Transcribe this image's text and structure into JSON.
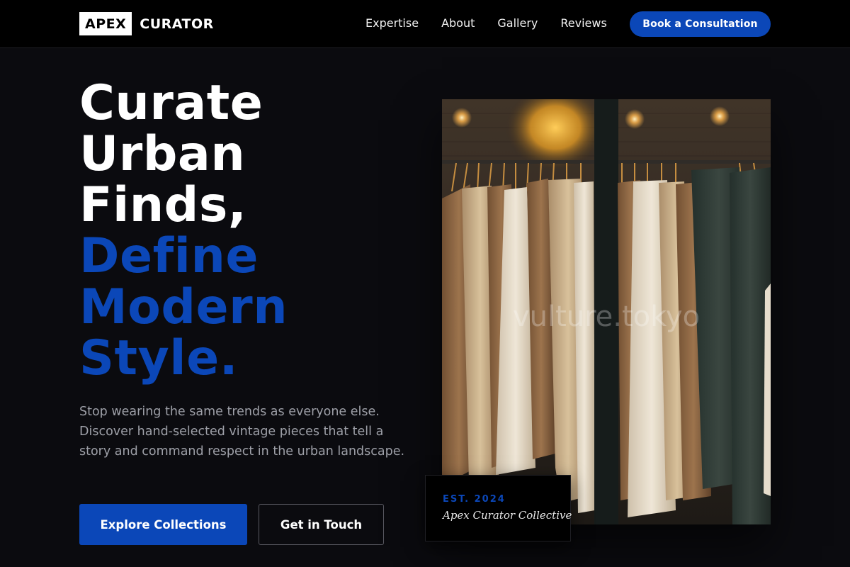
{
  "brand": {
    "logo_box": "APEX",
    "logo_text": "CURATOR"
  },
  "nav": {
    "links": [
      "Expertise",
      "About",
      "Gallery",
      "Reviews"
    ],
    "cta": "Book a Consultation"
  },
  "hero": {
    "headline_white": [
      "Curate",
      "Urban",
      "Finds,"
    ],
    "headline_accent": [
      "Define",
      "Modern",
      "Style."
    ],
    "subtext": "Stop wearing the same trends as everyone else. Discover hand-selected vintage pieces that tell a story and command respect in the urban landscape.",
    "primary_button": "Explore Collections",
    "secondary_button": "Get in Touch"
  },
  "image": {
    "watermark": "vulture.tokyo",
    "alt": "Clothing rack with knit sweaters in a vintage shop window"
  },
  "badge": {
    "est": "EST. 2024",
    "name": "Apex Curator Collective"
  },
  "colors": {
    "accent": "#0b47b8",
    "background": "#0b0b0f",
    "nav_bg": "#000000",
    "muted_text": "#9ea0a8"
  }
}
